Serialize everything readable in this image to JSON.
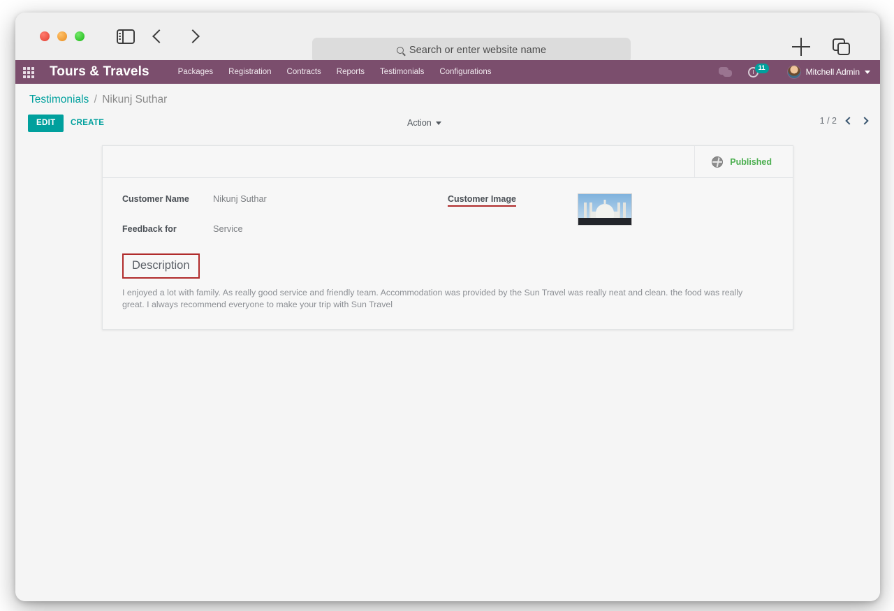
{
  "browser": {
    "search_placeholder": "Search or enter website name",
    "icons": {
      "sidebar_toggle": "sidebar-toggle-icon",
      "back": "back-chevron-icon",
      "forward": "forward-chevron-icon",
      "search": "search-icon",
      "new_tab": "plus-icon",
      "tab_overview": "tabs-icon"
    }
  },
  "navbar": {
    "apps_icon": "apps-grid-icon",
    "brand": "Tours & Travels",
    "menus": [
      {
        "label": "Packages"
      },
      {
        "label": "Registration"
      },
      {
        "label": "Contracts"
      },
      {
        "label": "Reports"
      },
      {
        "label": "Testimonials"
      },
      {
        "label": "Configurations"
      }
    ],
    "messages_icon": "chat-bubbles-icon",
    "activity_icon": "clock-icon",
    "activity_count": "11",
    "user_name": "Mitchell Admin",
    "color": "#7b4e6d",
    "accent": "#00a09d"
  },
  "control_panel": {
    "breadcrumb_root": "Testimonials",
    "breadcrumb_sep": "/",
    "breadcrumb_current": "Nikunj Suthar",
    "edit_label": "EDIT",
    "create_label": "CREATE",
    "action_label": "Action",
    "pager_text": "1 / 2"
  },
  "record": {
    "status_label": "Published",
    "status_color": "#4caf50",
    "fields": [
      {
        "label": "Customer Name",
        "value": "Nikunj Suthar"
      },
      {
        "label": "Feedback for",
        "value": "Service"
      }
    ],
    "image_label": "Customer Image",
    "image_alt": "taj-mahal-photo",
    "description_label": "Description",
    "description_text": "I enjoyed a lot with family. As really good service and friendly team. Accommodation  was provided by the Sun Travel was really neat and clean. the food was really great. I always recommend everyone to make your trip with Sun Travel"
  },
  "annotations": {
    "highlight_color": "#b02b2b",
    "boxes": [
      "published-status",
      "description-heading"
    ],
    "underlines": [
      "customer-image-label"
    ]
  }
}
